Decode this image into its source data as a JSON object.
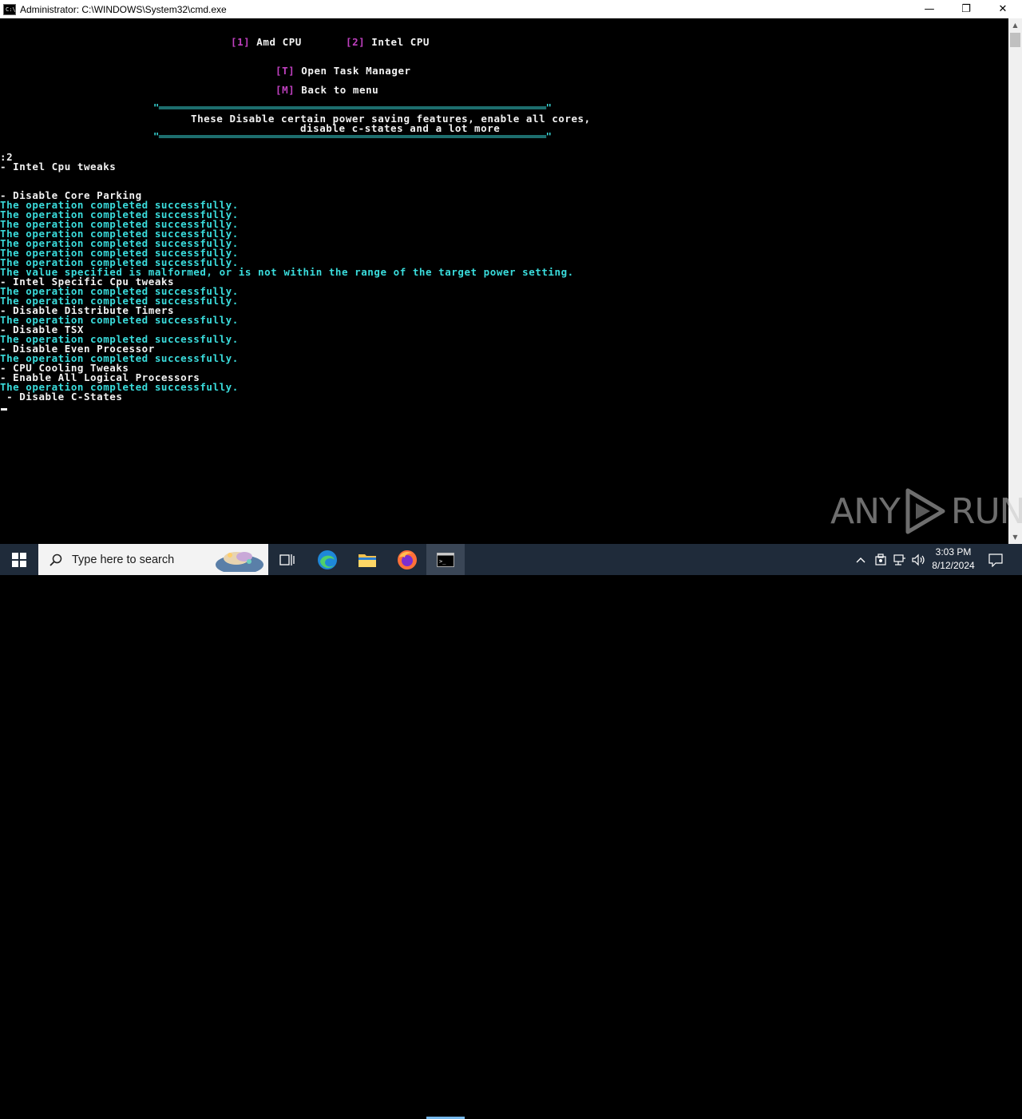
{
  "window": {
    "title": "Administrator: C:\\WINDOWS\\System32\\cmd.exe",
    "icon_label": "C:\\",
    "min_glyph": "—",
    "max_glyph": "❐",
    "close_glyph": "✕"
  },
  "console": {
    "menu": [
      {
        "key": "[1]",
        "label": " Amd CPU"
      },
      {
        "key": "[2]",
        "label": " Intel CPU"
      },
      {
        "key": "[T]",
        "label": " Open Task Manager"
      },
      {
        "key": "[M]",
        "label": " Back to menu"
      }
    ],
    "box_top": "\"══════════════════════════════════════════════════════════════════════\"",
    "box_text_1": "These Disable certain power saving features, enable all cores,",
    "box_text_2": "disable c-states and a lot more",
    "box_bottom": "\"══════════════════════════════════════════════════════════════════════\"",
    "output": [
      {
        "text": ":2",
        "style": "white"
      },
      {
        "text": "- Intel Cpu tweaks",
        "style": "white"
      },
      {
        "text": "",
        "style": "white"
      },
      {
        "text": "",
        "style": "white"
      },
      {
        "text": "- Disable Core Parking",
        "style": "white"
      },
      {
        "text": "The operation completed successfully.",
        "style": "cyan"
      },
      {
        "text": "The operation completed successfully.",
        "style": "cyan"
      },
      {
        "text": "The operation completed successfully.",
        "style": "cyan"
      },
      {
        "text": "The operation completed successfully.",
        "style": "cyan"
      },
      {
        "text": "The operation completed successfully.",
        "style": "cyan"
      },
      {
        "text": "The operation completed successfully.",
        "style": "cyan"
      },
      {
        "text": "The operation completed successfully.",
        "style": "cyan"
      },
      {
        "text": "The value specified is malformed, or is not within the range of the target power setting.",
        "style": "cyan"
      },
      {
        "text": "- Intel Specific Cpu tweaks",
        "style": "white"
      },
      {
        "text": "The operation completed successfully.",
        "style": "cyan"
      },
      {
        "text": "The operation completed successfully.",
        "style": "cyan"
      },
      {
        "text": "- Disable Distribute Timers",
        "style": "white"
      },
      {
        "text": "The operation completed successfully.",
        "style": "cyan"
      },
      {
        "text": "- Disable TSX",
        "style": "white"
      },
      {
        "text": "The operation completed successfully.",
        "style": "cyan"
      },
      {
        "text": "- Disable Even Processor",
        "style": "white"
      },
      {
        "text": "The operation completed successfully.",
        "style": "cyan"
      },
      {
        "text": "- CPU Cooling Tweaks",
        "style": "white"
      },
      {
        "text": "- Enable All Logical Processors",
        "style": "white"
      },
      {
        "text": "The operation completed successfully.",
        "style": "cyan"
      },
      {
        "text": " - Disable C-States",
        "style": "white"
      }
    ]
  },
  "watermark": {
    "left": "ANY",
    "right": "RUN"
  },
  "taskbar": {
    "search_placeholder": "Type here to search",
    "clock_time": "3:03 PM",
    "clock_date": "8/12/2024",
    "icons": [
      "windows-start-icon",
      "search-icon",
      "task-view-icon",
      "edge-icon",
      "file-explorer-icon",
      "firefox-icon",
      "cmd-icon",
      "chevron-up-icon",
      "meet-now-icon",
      "network-icon",
      "volume-icon",
      "notification-icon"
    ]
  },
  "colors": {
    "console_bg": "#000000",
    "console_text": "#f2f2f2",
    "console_cyan": "#3adcdc",
    "console_magenta": "#c040c0",
    "taskbar_bg": "#1f2b3a"
  }
}
